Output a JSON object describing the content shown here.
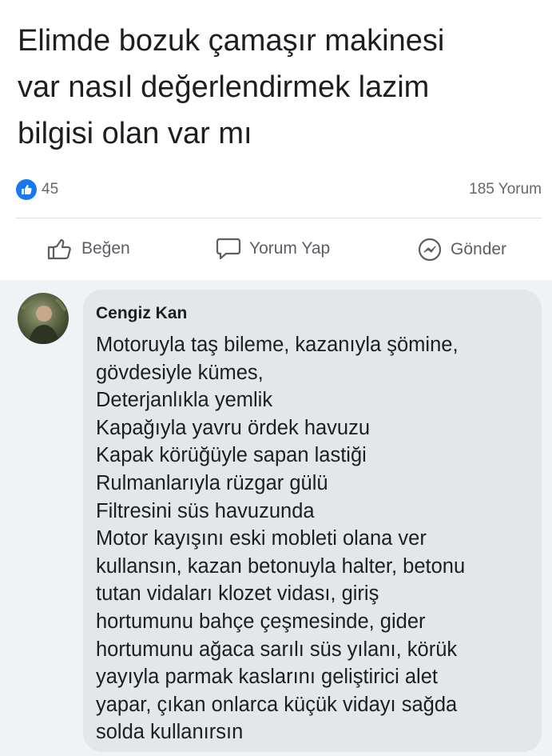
{
  "post": {
    "text": "Elimde  bozuk çamaşır makinesi\nvar  nasıl değerlendirmek lazim\nbilgisi olan var mı",
    "reactions_count": "45",
    "comments_count": "185 Yorum"
  },
  "actions": {
    "like": "Beğen",
    "comment": "Yorum Yap",
    "send": "Gönder"
  },
  "comment": {
    "author": "Cengiz Kan",
    "lines": [
      "Motoruyla taş bileme, kazanıyla şömine,",
      "gövdesiyle kümes,",
      "Deterjanlıkla yemlik",
      "Kapağıyla yavru ördek havuzu",
      "Kapak körüğüyle sapan lastiği",
      "Rulmanlarıyla rüzgar gülü",
      "Filtresini süs havuzunda",
      "Motor kayışını eski mobleti olana ver",
      "kullansın, kazan betonuyla halter, betonu",
      "tutan vidaları klozet vidası, giriş",
      "hortumunu bahçe çeşmesinde, gider",
      "hortumunu ağaca sarılı süs yılanı, körük",
      "yayıyla parmak kaslarını geliştirici alet",
      "yapar, çıkan onlarca küçük vidayı sağda",
      "solda kullanırsın"
    ]
  },
  "colors": {
    "accent": "#1877f2",
    "comment_bg": "#f0f2f5",
    "bubble_bg": "#e4e6ea",
    "secondary_text": "#65676b"
  }
}
